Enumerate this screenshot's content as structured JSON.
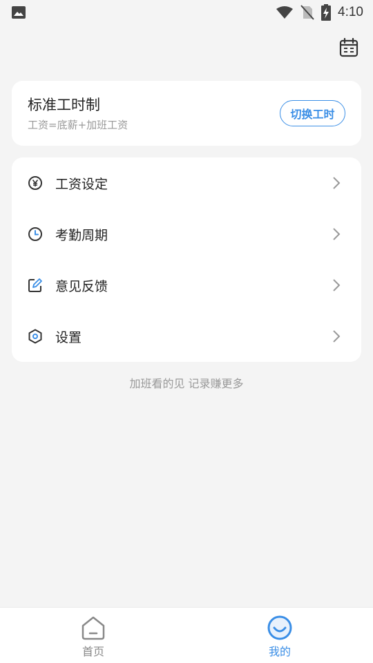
{
  "status_bar": {
    "time": "4:10",
    "icons": [
      "image-icon",
      "wifi-icon",
      "no-sim-icon",
      "battery-charging-icon"
    ]
  },
  "header": {
    "calendar_icon": "calendar-icon"
  },
  "mode_card": {
    "title": "标准工时制",
    "subtitle": "工资=底薪+加班工资",
    "switch_label": "切换工时"
  },
  "menu": {
    "items": [
      {
        "label": "工资设定",
        "icon": "yen-icon"
      },
      {
        "label": "考勤周期",
        "icon": "clock-icon"
      },
      {
        "label": "意见反馈",
        "icon": "edit-icon"
      },
      {
        "label": "设置",
        "icon": "settings-hexagon-icon"
      }
    ]
  },
  "slogan": "加班看的见 记录赚更多",
  "tab_bar": {
    "tabs": [
      {
        "label": "首页",
        "icon": "home-icon",
        "active": false
      },
      {
        "label": "我的",
        "icon": "smile-icon",
        "active": true
      }
    ]
  },
  "colors": {
    "accent": "#3a8ee6",
    "background": "#f4f4f4",
    "card": "#ffffff"
  }
}
